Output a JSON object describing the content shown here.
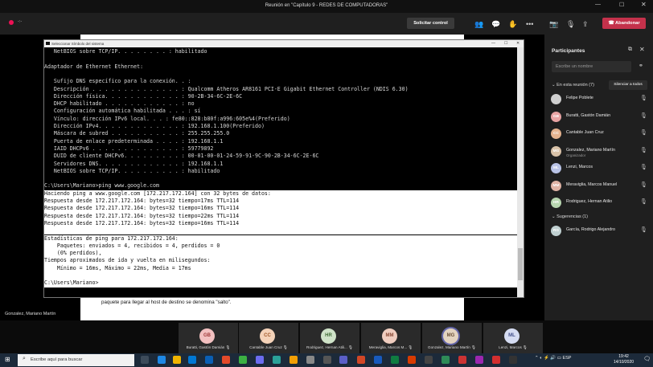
{
  "window_title": "Reunión en \"Capítulo 9 - REDES DE COMPUTADORAS\"",
  "toolbar": {
    "request_control": "Solicitar control",
    "leave": "Abandonar",
    "time_icon": "recording-dot-icon",
    "time_text": "-:-"
  },
  "cmd": {
    "title": "Seleccionar Símbolo del sistema",
    "lines": [
      "   NetBIOS sobre TCP/IP. . . . . . . . : habilitado",
      "",
      "Adaptador de Ethernet Ethernet:",
      "",
      "   Sufijo DNS específico para la conexión. . :",
      "   Descripción . . . . . . . . . . . . . . : Qualcomm Atheros AR8161 PCI-E Gigabit Ethernet Controller (NDIS 6.30)",
      "   Dirección física. . . . . . . . . . . . : 90-2B-34-6C-2E-6C",
      "   DHCP habilitado . . . . . . . . . . . . : no",
      "   Configuración automática habilitada . . . : sí",
      "   Vínculo: dirección IPv6 local. . . : fe80::828:b80f:a996:605e%4(Preferido)",
      "   Dirección IPv4. . . . . . . . . . . . . : 192.168.1.100(Preferido)",
      "   Máscara de subred . . . . . . . . . . . : 255.255.255.0",
      "   Puerta de enlace predeterminada . . . . : 192.168.1.1",
      "   IAID DHCPv6 . . . . . . . . . . . . . . : 59779892",
      "   DUID de cliente DHCPv6. . . . . . . . . : 00-01-00-01-24-59-91-9C-90-2B-34-6C-2E-6C",
      "   Servidores DNS. . . . . . . . . . . . . : 192.168.1.1",
      "   NetBIOS sobre TCP/IP. . . . . . . . . . : habilitado",
      "",
      "C:\\Users\\Mariano>ping www.google.com"
    ],
    "selected_lines": [
      "Haciendo ping a www.google.com [172.217.172.164] con 32 bytes de datos:",
      "Respuesta desde 172.217.172.164: bytes=32 tiempo=17ms TTL=114",
      "Respuesta desde 172.217.172.164: bytes=32 tiempo=16ms TTL=114",
      "Respuesta desde 172.217.172.164: bytes=32 tiempo=22ms TTL=114",
      "Respuesta desde 172.217.172.164: bytes=32 tiempo=16ms TTL=114",
      "",
      "Estadísticas de ping para 172.217.172.164:",
      "    Paquetes: enviados = 4, recibidos = 4, perdidos = 0",
      "    (0% perdidos),",
      "Tiempos aproximados de ida y vuelta en milisegundos:",
      "    Mínimo = 16ms, Máximo = 22ms, Media = 17ms",
      "",
      "C:\\Users\\Mariano>"
    ]
  },
  "slide_text": "paquete para llegar al host de destino se denomina \"salto\".",
  "presenter_name": "Gonzalez, Mariano Martín",
  "panel": {
    "title": "Participantes",
    "invite_placeholder": "Escribe un nombre",
    "in_meeting": "En esta reunión (7)",
    "mute_all": "Silenciar a todos",
    "suggestions": "Sugerencias (1)",
    "participants": [
      {
        "name": "Felipe Poblete",
        "initials": "",
        "color": "#cfcfcf",
        "role": ""
      },
      {
        "name": "Buratti, Gastón Damián",
        "initials": "GB",
        "color": "#e8a3a3",
        "role": ""
      },
      {
        "name": "Cantable Juan Cruz",
        "initials": "CC",
        "color": "#e6b38f",
        "role": ""
      },
      {
        "name": "Gonzalez, Mariano Martín",
        "initials": "MG",
        "color": "#d9c2a8",
        "role": "Organizador"
      },
      {
        "name": "Lenzi, Marcos",
        "initials": "ML",
        "color": "#b9c3e6",
        "role": ""
      },
      {
        "name": "Meraviglia, Marcos Manuel",
        "initials": "MM",
        "color": "#e0b3a5",
        "role": ""
      },
      {
        "name": "Rodriguez, Hernan Atilio",
        "initials": "HR",
        "color": "#b8d6b0",
        "role": ""
      }
    ],
    "suggested": [
      {
        "name": "García, Rodrigo Alejandro",
        "initials": "RG",
        "color": "#bfcfd0"
      }
    ]
  },
  "gallery": [
    {
      "name": "Buratti, Gastón Damián",
      "initials": "GB",
      "color": "#f2c0c0",
      "text": "#a03a3a"
    },
    {
      "name": "Cantable Juan Cruz",
      "initials": "CC",
      "color": "#f4d2b8",
      "text": "#a0582a"
    },
    {
      "name": "Rodriguez, Hernan Atili...",
      "initials": "HR",
      "color": "#cfe3c8",
      "text": "#3f6b35"
    },
    {
      "name": "Meraviglia, Marcos M...",
      "initials": "MM",
      "color": "#f0cdbf",
      "text": "#8a4a36"
    },
    {
      "name": "Gonzalez, Mariano Martín",
      "initials": "MG",
      "color": "#e3d3c0",
      "text": "#6b5038"
    },
    {
      "name": "Lenzi, Marcos",
      "initials": "ML",
      "color": "#d5dcf2",
      "text": "#43508a"
    }
  ],
  "taskbar": {
    "search_placeholder": "Escribe aquí para buscar",
    "lang": "ESP",
    "time": "19:42",
    "date": "14/10/2020"
  }
}
